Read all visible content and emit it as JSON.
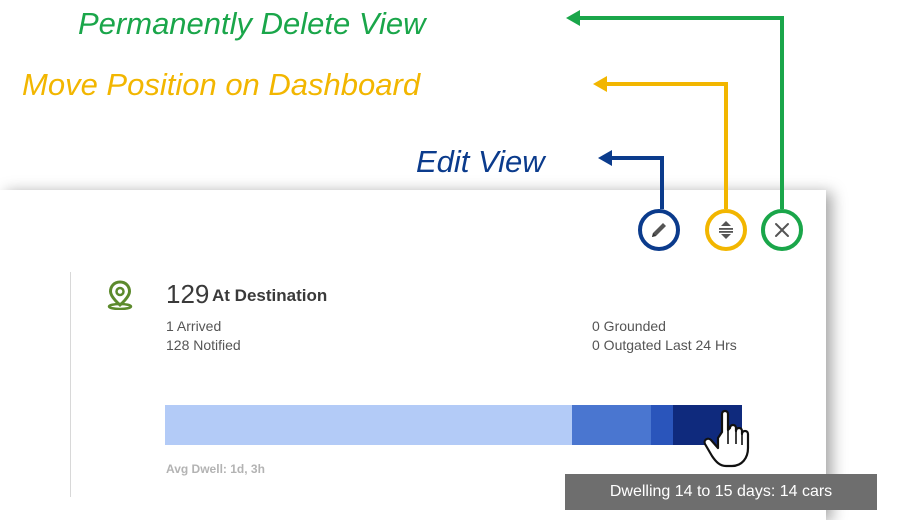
{
  "annotations": {
    "delete": "Permanently Delete View",
    "move": "Move Position on Dashboard",
    "edit": "Edit View"
  },
  "colors": {
    "delete": "#1aa64a",
    "move": "#f2b600",
    "edit": "#0b3b8c"
  },
  "card": {
    "count": "129",
    "title": "At Destination",
    "stats": {
      "arrived": "1 Arrived",
      "notified": "128 Notified",
      "grounded": "0 Grounded",
      "outgated": "0 Outgated Last 24 Hrs"
    },
    "avg_dwell": "Avg Dwell: 1d, 3h",
    "dwell_bar": [
      {
        "fraction": 0.706,
        "color": "#b3cbf7"
      },
      {
        "fraction": 0.137,
        "color": "#4a76d0"
      },
      {
        "fraction": 0.038,
        "color": "#2a55bb"
      },
      {
        "fraction": 0.119,
        "color": "#0f2a7d"
      }
    ],
    "tooltip": "Dwelling 14 to 15 days: 14 cars"
  },
  "icons": {
    "edit": "pencil-icon",
    "move": "reorder-icon",
    "delete": "close-icon",
    "location": "location-pin-icon",
    "cursor": "hand-pointer-icon"
  }
}
